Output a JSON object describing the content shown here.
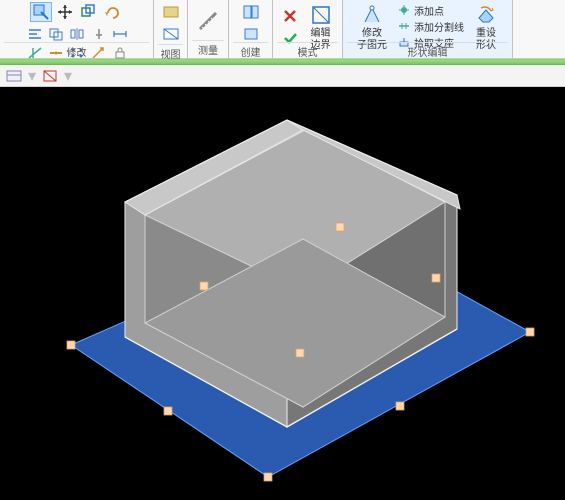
{
  "ribbon": {
    "panels": {
      "modify": {
        "label": "修改"
      },
      "view": {
        "label": "视图"
      },
      "measure": {
        "label": "测量"
      },
      "create": {
        "label": "创建"
      },
      "mode": {
        "label": "模式"
      },
      "shape": {
        "label": "形状编辑"
      }
    },
    "buttons": {
      "edit_boundary": {
        "line1": "编辑",
        "line2": "边界"
      },
      "modify_subelem": {
        "line1": "修改",
        "line2": "子图元"
      },
      "reset_shape": {
        "line1": "重设",
        "line2": "形状"
      },
      "add_point": "添加点",
      "add_split": "添加分割线",
      "pick_support": "拾取支座"
    }
  }
}
